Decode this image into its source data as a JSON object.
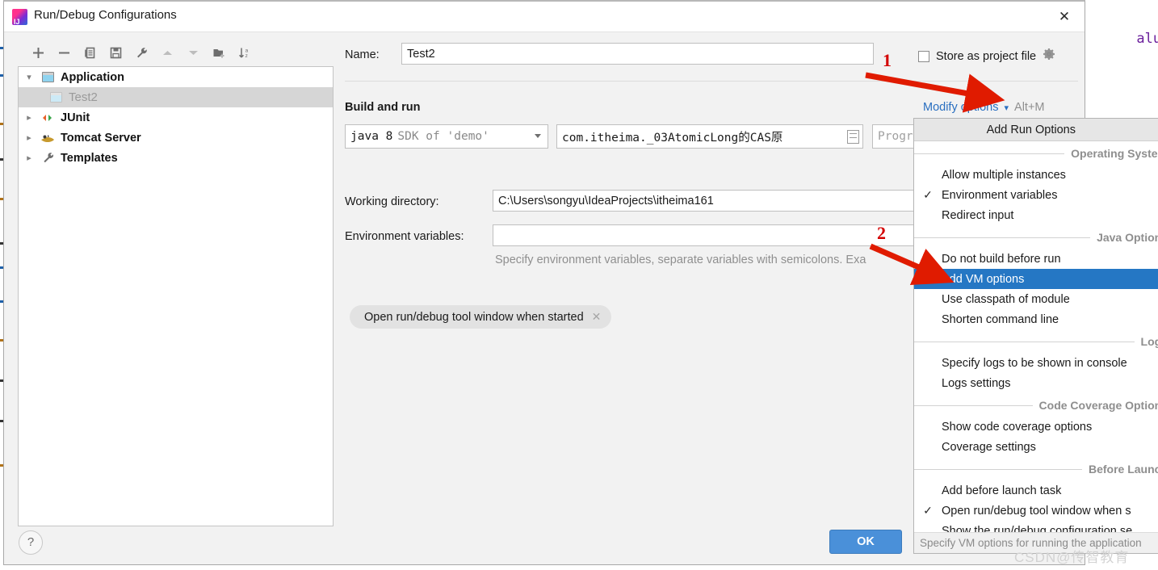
{
  "window": {
    "title": "Run/Debug Configurations",
    "app_icon": "intellij-idea-icon",
    "close_icon": "close-icon"
  },
  "editor_background": {
    "right_code_fragment": "alue);",
    "right_code_ident": "alue",
    "right_code_punct": ");"
  },
  "tree_toolbar": {
    "icons": [
      {
        "name": "add-icon",
        "glyph": "+",
        "enabled": true
      },
      {
        "name": "remove-icon",
        "glyph": "−",
        "enabled": true
      },
      {
        "name": "copy-icon",
        "glyph": "copy",
        "enabled": true
      },
      {
        "name": "save-icon",
        "glyph": "save",
        "enabled": true
      },
      {
        "name": "edit-templates-wrench-icon",
        "glyph": "wrench",
        "enabled": true
      },
      {
        "name": "move-up-icon",
        "glyph": "triangle-up",
        "enabled": false
      },
      {
        "name": "move-down-icon",
        "glyph": "triangle-down",
        "enabled": true
      },
      {
        "name": "new-folder-icon",
        "glyph": "folder-plus",
        "enabled": true
      },
      {
        "name": "sort-alphabetically-icon",
        "glyph": "sort-az",
        "enabled": true
      }
    ]
  },
  "tree": {
    "nodes": [
      {
        "label": "Application",
        "twisty": "expanded",
        "icon": "application-window-icon",
        "selected": false,
        "child": false
      },
      {
        "label": "Test2",
        "twisty": "none",
        "icon": "application-window-icon",
        "selected": true,
        "child": true
      },
      {
        "label": "JUnit",
        "twisty": "collapsed",
        "icon": "junit-icon",
        "selected": false,
        "child": false
      },
      {
        "label": "Tomcat Server",
        "twisty": "collapsed",
        "icon": "tomcat-icon",
        "selected": false,
        "child": false
      },
      {
        "label": "Templates",
        "twisty": "collapsed",
        "icon": "wrench-icon",
        "selected": false,
        "child": false
      }
    ]
  },
  "form": {
    "name_label": "Name:",
    "name_value": "Test2",
    "store_as_project_file_label": "Store as project file",
    "store_as_project_file_checked": false,
    "store_gear_icon": "gear-icon",
    "section_title": "Build and run",
    "modify_options_label": "Modify options",
    "modify_options_shortcut": "Alt+M",
    "modify_caret_icon": "chevron-down-icon",
    "sdk_primary": "java 8",
    "sdk_secondary": "SDK of 'demo'",
    "main_class_value": "com.itheima._03AtomicLong的CAS原",
    "main_class_browse_icon": "browse-class-icon",
    "program_arguments_placeholder": "Progr",
    "working_directory_label": "Working directory:",
    "working_directory_value": "C:\\Users\\songyu\\IdeaProjects\\itheima161",
    "environment_variables_label": "Environment variables:",
    "environment_variables_value": "",
    "environment_hint": "Specify environment variables, separate variables with semicolons. Exa",
    "chip_label": "Open run/debug tool window when started",
    "chip_close_icon": "close-icon"
  },
  "footer": {
    "help_label": "?",
    "help_icon": "help-icon",
    "ok_label": "OK"
  },
  "popup": {
    "header": "Add Run Options",
    "status_hint": "Specify VM options for running the application",
    "groups": [
      {
        "title": "Operating System",
        "items": [
          {
            "label": "Allow multiple instances",
            "checked": false,
            "selected": false
          },
          {
            "label": "Environment variables",
            "checked": true,
            "selected": false
          },
          {
            "label": "Redirect input",
            "checked": false,
            "selected": false
          }
        ]
      },
      {
        "title": "Java Options",
        "items": [
          {
            "label": "Do not build before run",
            "checked": false,
            "selected": false
          },
          {
            "label": "Add VM options",
            "checked": false,
            "selected": true
          },
          {
            "label": "Use classpath of module",
            "checked": false,
            "selected": false
          },
          {
            "label": "Shorten command line",
            "checked": false,
            "selected": false
          }
        ]
      },
      {
        "title": "Logs",
        "items": [
          {
            "label": "Specify logs to be shown in console",
            "checked": false,
            "selected": false
          },
          {
            "label": "Logs settings",
            "checked": false,
            "selected": false
          }
        ]
      },
      {
        "title": "Code Coverage Options",
        "items": [
          {
            "label": "Show code coverage options",
            "checked": false,
            "selected": false
          },
          {
            "label": "Coverage settings",
            "checked": false,
            "selected": false
          }
        ]
      },
      {
        "title": "Before Launch",
        "items": [
          {
            "label": "Add before launch task",
            "checked": false,
            "selected": false
          },
          {
            "label": "Open run/debug tool window when s",
            "checked": true,
            "selected": false
          },
          {
            "label": "Show the run/debug configuration se",
            "checked": false,
            "selected": false
          }
        ]
      }
    ]
  },
  "annotations": {
    "marker_1": "1",
    "marker_2": "2",
    "arrow_color": "#e01b00"
  },
  "watermark": "CSDN@传智教育",
  "colors": {
    "accent_blue": "#2577c4",
    "link_blue": "#2a6fc0",
    "ok_button": "#4a90d9",
    "selection_gray": "#d6d6d6",
    "dialog_bg": "#f2f2f2",
    "annotation_red": "#e01b00"
  }
}
